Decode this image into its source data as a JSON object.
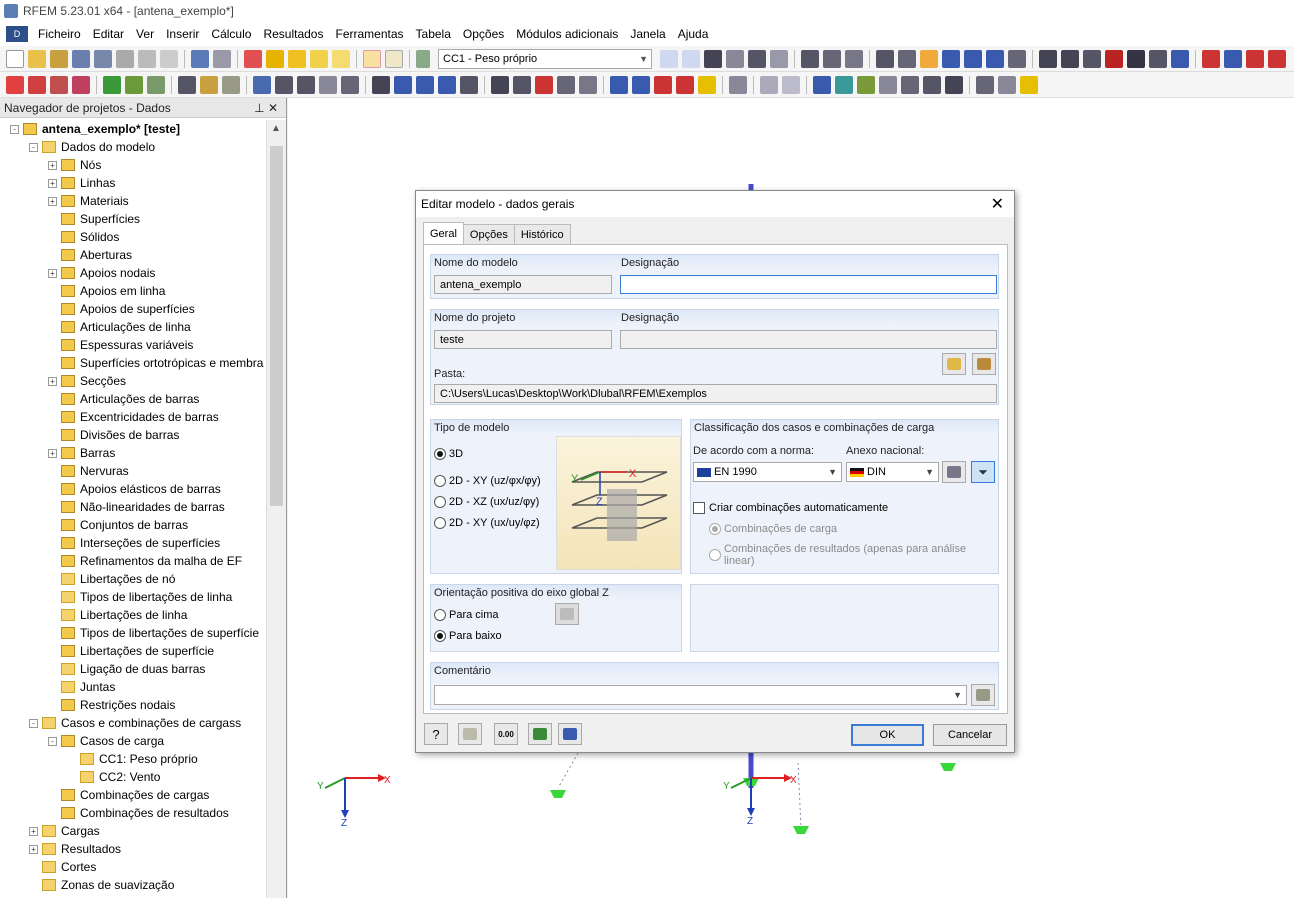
{
  "window": {
    "title": "RFEM 5.23.01 x64 - [antena_exemplo*]"
  },
  "menu": [
    "Ficheiro",
    "Editar",
    "Ver",
    "Inserir",
    "Cálculo",
    "Resultados",
    "Ferramentas",
    "Tabela",
    "Opções",
    "Módulos adicionais",
    "Janela",
    "Ajuda"
  ],
  "toolbar": {
    "load_case": "CC1 - Peso próprio"
  },
  "navigator": {
    "title": "Navegador de projetos - Dados",
    "items": [
      {
        "label": "antena_exemplo* [teste]",
        "level": 0,
        "exp": "-",
        "bold": true
      },
      {
        "label": "Dados do modelo",
        "level": 1,
        "exp": "-",
        "folder": true
      },
      {
        "label": "Nós",
        "level": 2,
        "exp": "+"
      },
      {
        "label": "Linhas",
        "level": 2,
        "exp": "+"
      },
      {
        "label": "Materiais",
        "level": 2,
        "exp": "+"
      },
      {
        "label": "Superfícies",
        "level": 2,
        "exp": ""
      },
      {
        "label": "Sólidos",
        "level": 2,
        "exp": ""
      },
      {
        "label": "Aberturas",
        "level": 2,
        "exp": ""
      },
      {
        "label": "Apoios nodais",
        "level": 2,
        "exp": "+"
      },
      {
        "label": "Apoios em linha",
        "level": 2,
        "exp": ""
      },
      {
        "label": "Apoios de superfícies",
        "level": 2,
        "exp": ""
      },
      {
        "label": "Articulações de linha",
        "level": 2,
        "exp": ""
      },
      {
        "label": "Espessuras variáveis",
        "level": 2,
        "exp": ""
      },
      {
        "label": "Superfícies ortotrópicas e membra",
        "level": 2,
        "exp": ""
      },
      {
        "label": "Secções",
        "level": 2,
        "exp": "+"
      },
      {
        "label": "Articulações de barras",
        "level": 2,
        "exp": ""
      },
      {
        "label": "Excentricidades de barras",
        "level": 2,
        "exp": ""
      },
      {
        "label": "Divisões de barras",
        "level": 2,
        "exp": ""
      },
      {
        "label": "Barras",
        "level": 2,
        "exp": "+"
      },
      {
        "label": "Nervuras",
        "level": 2,
        "exp": ""
      },
      {
        "label": "Apoios elásticos de barras",
        "level": 2,
        "exp": ""
      },
      {
        "label": "Não-linearidades de barras",
        "level": 2,
        "exp": ""
      },
      {
        "label": "Conjuntos de barras",
        "level": 2,
        "exp": ""
      },
      {
        "label": "Interseções de superfícies",
        "level": 2,
        "exp": ""
      },
      {
        "label": "Refinamentos da malha de EF",
        "level": 2,
        "exp": ""
      },
      {
        "label": "Libertações de nó",
        "level": 2,
        "exp": "",
        "folder": true
      },
      {
        "label": "Tipos de libertações de linha",
        "level": 2,
        "exp": "",
        "folder": true
      },
      {
        "label": "Libertações de linha",
        "level": 2,
        "exp": "",
        "folder": true
      },
      {
        "label": "Tipos de libertações de superfície",
        "level": 2,
        "exp": ""
      },
      {
        "label": "Libertações de superfície",
        "level": 2,
        "exp": ""
      },
      {
        "label": "Ligação de duas barras",
        "level": 2,
        "exp": "",
        "folder": true
      },
      {
        "label": "Juntas",
        "level": 2,
        "exp": "",
        "folder": true
      },
      {
        "label": "Restrições nodais",
        "level": 2,
        "exp": ""
      },
      {
        "label": "Casos e combinações de cargass",
        "level": 1,
        "exp": "-",
        "folder": true
      },
      {
        "label": "Casos de carga",
        "level": 2,
        "exp": "-"
      },
      {
        "label": "CC1: Peso próprio",
        "level": 3,
        "exp": "",
        "folder": true
      },
      {
        "label": "CC2: Vento",
        "level": 3,
        "exp": "",
        "folder": true
      },
      {
        "label": "Combinações de cargas",
        "level": 2,
        "exp": ""
      },
      {
        "label": "Combinações de resultados",
        "level": 2,
        "exp": ""
      },
      {
        "label": "Cargas",
        "level": 1,
        "exp": "+",
        "folder": true
      },
      {
        "label": "Resultados",
        "level": 1,
        "exp": "+",
        "folder": true
      },
      {
        "label": "Cortes",
        "level": 1,
        "exp": "",
        "folder": true
      },
      {
        "label": "Zonas de suavização",
        "level": 1,
        "exp": "",
        "folder": true
      }
    ]
  },
  "axes": {
    "x": "X",
    "y": "Y",
    "z": "Z"
  },
  "dialog": {
    "title": "Editar modelo - dados gerais",
    "tabs": [
      "Geral",
      "Opções",
      "Histórico"
    ],
    "model_name_label": "Nome do modelo",
    "model_name": "antena_exemplo",
    "designation_label": "Designação",
    "model_designation": "",
    "project_name_label": "Nome do projeto",
    "project_name": "teste",
    "project_designation": "",
    "folder_label": "Pasta:",
    "folder": "C:\\Users\\Lucas\\Desktop\\Work\\Dlubal\\RFEM\\Exemplos",
    "model_type_label": "Tipo de modelo",
    "model_types": [
      "3D",
      "2D - XY (uz/φx/φy)",
      "2D - XZ (ux/uz/φy)",
      "2D - XY (ux/uy/φz)"
    ],
    "classification_label": "Classificação dos casos e combinações de carga",
    "norm_label": "De acordo com a norma:",
    "norm_value": "EN 1990",
    "annex_label": "Anexo nacional:",
    "annex_value": "DIN",
    "auto_comb_label": "Criar combinações automaticamente",
    "comb_load": "Combinações de carga",
    "comb_results": "Combinações de resultados (apenas para análise linear)",
    "orientation_label": "Orientação positiva do eixo global Z",
    "orient_up": "Para cima",
    "orient_down": "Para baixo",
    "comment_label": "Comentário",
    "comment": "",
    "ok": "OK",
    "cancel": "Cancelar"
  },
  "colors": {
    "accent": "#3a7bd5",
    "axis_x": "#e0201c",
    "axis_y": "#2a9a2a",
    "axis_z": "#1f3fb8"
  }
}
